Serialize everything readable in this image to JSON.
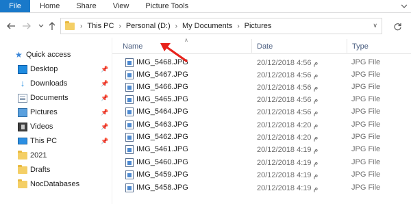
{
  "ribbon": {
    "file_label": "File",
    "tabs": [
      "Home",
      "Share",
      "View",
      "Picture Tools"
    ]
  },
  "address": {
    "crumbs": [
      "This PC",
      "Personal (D:)",
      "My Documents",
      "Pictures"
    ]
  },
  "nav_pane": {
    "quick_access": "Quick access",
    "items": [
      {
        "label": "Desktop",
        "icon": "desktop-icon",
        "pinned": true
      },
      {
        "label": "Downloads",
        "icon": "downloads-icon",
        "pinned": true
      },
      {
        "label": "Documents",
        "icon": "documents-icon",
        "pinned": true
      },
      {
        "label": "Pictures",
        "icon": "pictures-icon",
        "pinned": true
      },
      {
        "label": "Videos",
        "icon": "videos-icon",
        "pinned": true
      },
      {
        "label": "This PC",
        "icon": "this-pc-icon",
        "pinned": true
      },
      {
        "label": "2021",
        "icon": "folder-icon",
        "pinned": false
      },
      {
        "label": "Drafts",
        "icon": "folder-icon",
        "pinned": false
      },
      {
        "label": "NocDatabases",
        "icon": "folder-icon",
        "pinned": false
      }
    ]
  },
  "file_list": {
    "columns": {
      "name": "Name",
      "date": "Date",
      "type": "Type"
    },
    "rows": [
      {
        "name": "IMG_5468.JPG",
        "date": "20/12/2018 4:56 م",
        "type": "JPG File"
      },
      {
        "name": "IMG_5467.JPG",
        "date": "20/12/2018 4:56 م",
        "type": "JPG File"
      },
      {
        "name": "IMG_5466.JPG",
        "date": "20/12/2018 4:56 م",
        "type": "JPG File"
      },
      {
        "name": "IMG_5465.JPG",
        "date": "20/12/2018 4:56 م",
        "type": "JPG File"
      },
      {
        "name": "IMG_5464.JPG",
        "date": "20/12/2018 4:56 م",
        "type": "JPG File"
      },
      {
        "name": "IMG_5463.JPG",
        "date": "20/12/2018 4:20 م",
        "type": "JPG File"
      },
      {
        "name": "IMG_5462.JPG",
        "date": "20/12/2018 4:20 م",
        "type": "JPG File"
      },
      {
        "name": "IMG_5461.JPG",
        "date": "20/12/2018 4:19 م",
        "type": "JPG File"
      },
      {
        "name": "IMG_5460.JPG",
        "date": "20/12/2018 4:19 م",
        "type": "JPG File"
      },
      {
        "name": "IMG_5459.JPG",
        "date": "20/12/2018 4:19 م",
        "type": "JPG File"
      },
      {
        "name": "IMG_5458.JPG",
        "date": "20/12/2018 4:19 م",
        "type": "JPG File"
      }
    ]
  },
  "colors": {
    "file_tab_bg": "#1979ca",
    "annotation_arrow": "#e8221b",
    "column_header_text": "#4d6082"
  }
}
